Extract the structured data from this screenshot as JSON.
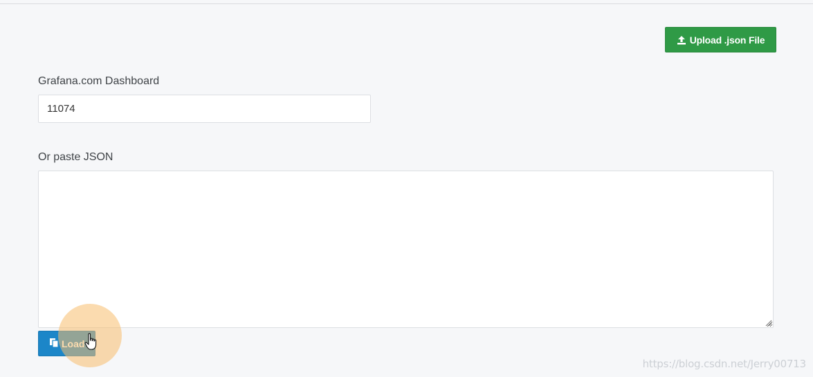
{
  "upload": {
    "label": "Upload .json File",
    "icon": "upload-icon",
    "color": "#2f9a46"
  },
  "grafana_com": {
    "label": "Grafana.com Dashboard",
    "value": "11074"
  },
  "paste_json": {
    "label": "Or paste JSON",
    "value": ""
  },
  "load": {
    "label": "Load",
    "icon": "copy-icon",
    "color": "#1c86c8"
  },
  "watermark": "https://blog.csdn.net/Jerry00713"
}
